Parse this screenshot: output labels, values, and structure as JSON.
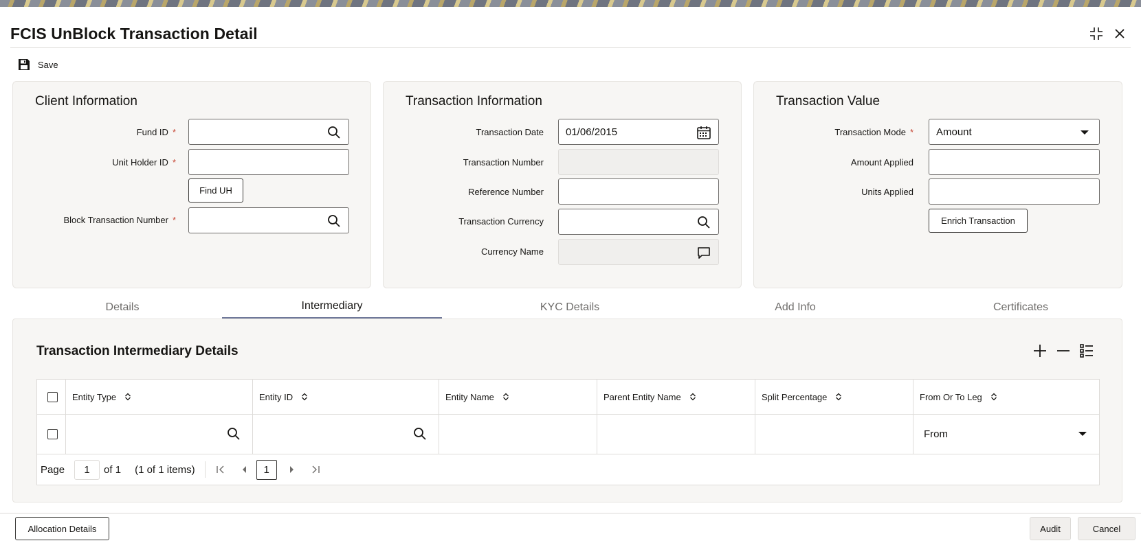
{
  "window": {
    "title": "FCIS UnBlock Transaction Detail"
  },
  "toolbar": {
    "save_label": "Save"
  },
  "client_info": {
    "title": "Client Information",
    "fund_id_label": "Fund ID",
    "fund_id_value": "",
    "unit_holder_id_label": "Unit Holder ID",
    "unit_holder_id_value": "",
    "find_uh_label": "Find UH",
    "block_txn_label": "Block Transaction Number",
    "block_txn_value": "",
    "required_mark": "*"
  },
  "txn_info": {
    "title": "Transaction Information",
    "date_label": "Transaction Date",
    "date_value": "01/06/2015",
    "number_label": "Transaction Number",
    "number_value": "",
    "reference_label": "Reference Number",
    "reference_value": "",
    "currency_label": "Transaction Currency",
    "currency_value": "",
    "currency_name_label": "Currency Name",
    "currency_name_value": ""
  },
  "txn_value": {
    "title": "Transaction Value",
    "mode_label": "Transaction Mode",
    "mode_value": "Amount",
    "amount_label": "Amount Applied",
    "amount_value": "",
    "units_label": "Units Applied",
    "units_value": "",
    "enrich_label": "Enrich Transaction"
  },
  "tabs": [
    {
      "label": "Details",
      "active": false
    },
    {
      "label": "Intermediary",
      "active": true
    },
    {
      "label": "KYC Details",
      "active": false
    },
    {
      "label": "Add Info",
      "active": false
    },
    {
      "label": "Certificates",
      "active": false
    }
  ],
  "intermediary": {
    "title": "Transaction Intermediary Details",
    "columns": [
      "Entity Type",
      "Entity ID",
      "Entity Name",
      "Parent Entity Name",
      "Split Percentage",
      "From Or To Leg"
    ],
    "rows": [
      {
        "entity_type": "",
        "entity_id": "",
        "entity_name": "",
        "parent_entity_name": "",
        "split_percentage": "",
        "leg": "From"
      }
    ],
    "pager": {
      "page_label": "Page",
      "page_value": "1",
      "of_label": "of 1",
      "items_label": "(1 of 1 items)",
      "current": "1"
    }
  },
  "footer": {
    "allocation_label": "Allocation Details",
    "audit_label": "Audit",
    "cancel_label": "Cancel"
  },
  "colors": {
    "accent": "#6f7899",
    "required": "#c74634",
    "panel_bg": "#f7f6f4"
  }
}
